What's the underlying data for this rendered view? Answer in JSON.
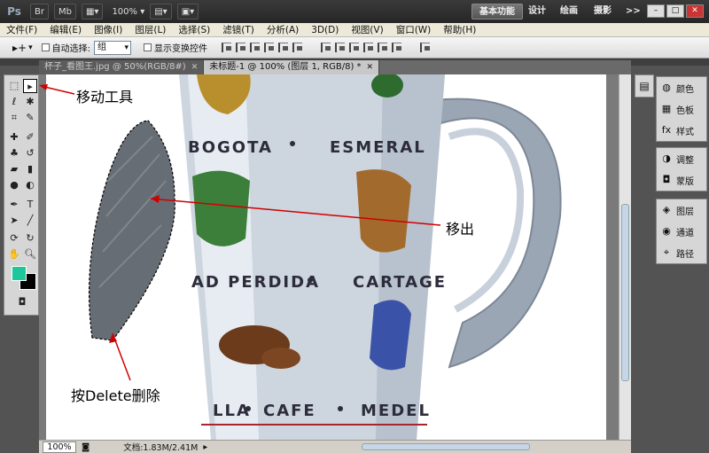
{
  "titlebar": {
    "app_logo": "Ps",
    "btn_br": "Br",
    "btn_mb": "Mb",
    "zoom": "100%",
    "workspaces": [
      "基本功能",
      "设计",
      "绘画",
      "摄影"
    ],
    "more": ">>",
    "win_min": "–",
    "win_max": "□",
    "win_close": "✕"
  },
  "menubar": {
    "items": [
      "文件(F)",
      "编辑(E)",
      "图像(I)",
      "图层(L)",
      "选择(S)",
      "滤镜(T)",
      "分析(A)",
      "3D(D)",
      "视图(V)",
      "窗口(W)",
      "帮助(H)"
    ]
  },
  "options": {
    "tool_glyph": "▸+",
    "auto_select_label": "自动选择:",
    "auto_select_value": "组",
    "show_transform_label": "显示变换控件"
  },
  "tabs": [
    {
      "label": "杯子_看图王.jpg @ 50%(RGB/8#)",
      "close": "✕"
    },
    {
      "label": "未标题-1 @ 100% (图层 1, RGB/8) *",
      "close": "✕"
    }
  ],
  "canvas": {
    "mug_words": {
      "bogota": "BOGOTA",
      "esmeral": "ESMERAL",
      "perdida": "AD PERDIDA",
      "cartage": "CARTAGE",
      "lla": "LLA",
      "cafe": "CAFE",
      "medel": "MEDEL"
    }
  },
  "annotations": {
    "move_tool": "移动工具",
    "move_out": "移出",
    "delete": "按Delete删除"
  },
  "statusbar": {
    "zoom": "100%",
    "doc_info": "文档:1.83M/2.41M"
  },
  "rightdock": {
    "group1": [
      "颜色",
      "色板",
      "样式"
    ],
    "group2": [
      "调整",
      "蒙版"
    ],
    "group3": [
      "图层",
      "通道",
      "路径"
    ]
  },
  "colors": {
    "foreground": "#1ec79a",
    "background": "#000000",
    "annotation_arrow": "#d00000"
  }
}
